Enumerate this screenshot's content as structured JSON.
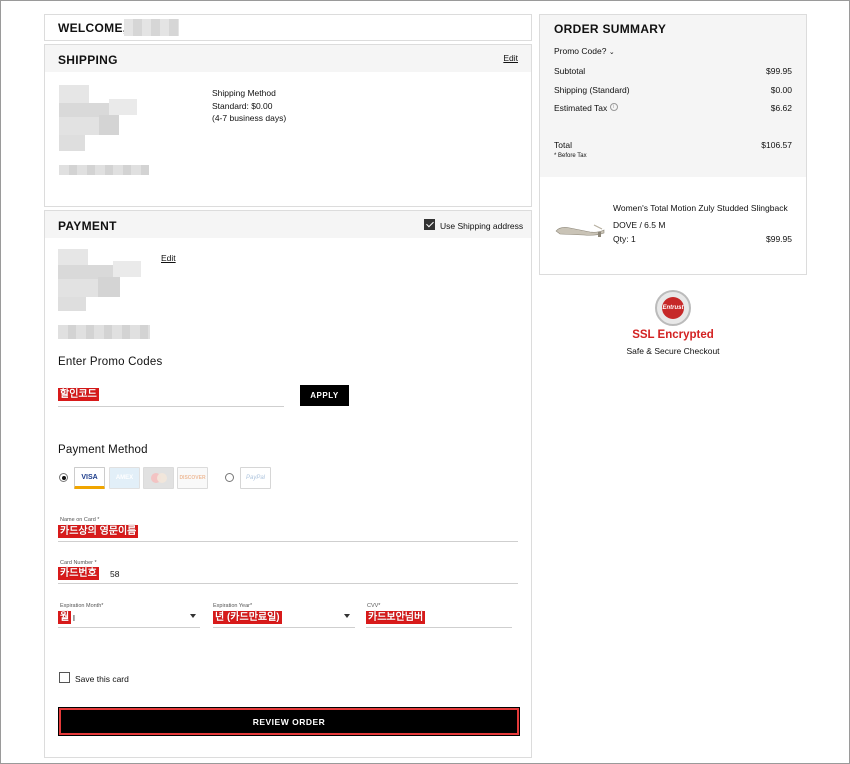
{
  "welcome": {
    "label": "WELCOME,"
  },
  "shipping": {
    "title": "SHIPPING",
    "edit_label": "Edit",
    "method_title": "Shipping Method",
    "method_price": "Standard: $0.00",
    "method_eta": "(4-7 business days)"
  },
  "payment": {
    "title": "PAYMENT",
    "use_shipping_label": "Use Shipping address",
    "use_shipping_checked": true,
    "edit_label": "Edit",
    "promo_heading": "Enter Promo Codes",
    "promo_placeholder": "할인코드",
    "apply_label": "APPLY",
    "method_heading": "Payment Method",
    "cards": [
      {
        "name": "visa-icon",
        "label": "VISA",
        "selected": true
      },
      {
        "name": "amex-icon",
        "label": "AMEX"
      },
      {
        "name": "mastercard-icon",
        "label": ""
      },
      {
        "name": "discover-icon",
        "label": "DISCOVER"
      }
    ],
    "paypal_label": "PayPal",
    "name_on_card": {
      "label": "Name on Card *",
      "value": "카드상의 영문이름"
    },
    "card_number": {
      "label": "Card Number *",
      "value": "카드번호",
      "suffix": "58"
    },
    "exp_month": {
      "label": "Expiration Month*",
      "value": "월",
      "suffix": "l"
    },
    "exp_year": {
      "label": "Expiration Year*",
      "value": "년 (카드만료일)"
    },
    "cvv": {
      "label": "CVV*",
      "value": "카드보안넘버"
    },
    "save_card_label": "Save this card",
    "review_label": "REVIEW ORDER"
  },
  "summary": {
    "title": "ORDER SUMMARY",
    "promo_toggle": "Promo Code?",
    "rows": [
      {
        "label": "Subtotal",
        "value": "$99.95"
      },
      {
        "label": "Shipping (Standard)",
        "value": "$0.00"
      },
      {
        "label": "Estimated Tax",
        "value": "$6.62"
      }
    ],
    "total_label": "Total",
    "total_value": "$106.57",
    "before_tax": "* Before Tax",
    "item": {
      "name": "Women's Total Motion Zuly Studded Slingback",
      "variant": "DOVE / 6.5 M",
      "qty": "Qty: 1",
      "price": "$99.95"
    }
  },
  "trust": {
    "seal_label": "Entrust",
    "ssl_label": "SSL Encrypted",
    "secure_label": "Safe & Secure Checkout"
  },
  "colors": {
    "accent_red": "#d32222",
    "button_black": "#000000",
    "panel_bg": "#f5f5f5"
  }
}
